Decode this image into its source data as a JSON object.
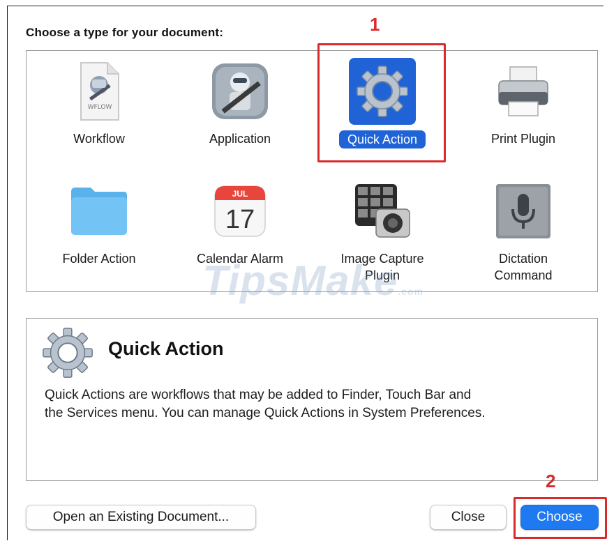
{
  "dialog": {
    "heading": "Choose a type for your document:",
    "types": [
      {
        "label": "Workflow",
        "icon": "workflow-file-icon",
        "icon_caption": "WFLOW"
      },
      {
        "label": "Application",
        "icon": "automator-robot-icon"
      },
      {
        "label": "Quick Action",
        "icon": "gear-icon",
        "selected": true
      },
      {
        "label": "Print Plugin",
        "icon": "printer-icon"
      },
      {
        "label": "Folder Action",
        "icon": "folder-icon"
      },
      {
        "label": "Calendar Alarm",
        "icon": "calendar-icon",
        "icon_month": "JUL",
        "icon_day": "17"
      },
      {
        "label": "Image Capture Plugin",
        "label_lines": [
          "Image Capture",
          "Plugin"
        ],
        "icon": "image-capture-icon"
      },
      {
        "label": "Dictation Command",
        "label_lines": [
          "Dictation",
          "Command"
        ],
        "icon": "microphone-icon"
      }
    ],
    "description": {
      "title": "Quick Action",
      "icon": "gear-icon",
      "text_lines": [
        "Quick Actions are workflows that may be added to Finder, Touch Bar and",
        "the Services menu. You can manage Quick Actions in System Preferences."
      ]
    },
    "buttons": {
      "open_existing": "Open an Existing Document...",
      "close": "Close",
      "choose": "Choose"
    }
  },
  "annotations": {
    "step1": "1",
    "step2": "2"
  },
  "watermark": {
    "brand": "TipsMake",
    "suffix": ".com"
  },
  "colors": {
    "accent": "#1f63d6",
    "choose_button": "#1f7af1",
    "annotation": "#d92b2b"
  }
}
